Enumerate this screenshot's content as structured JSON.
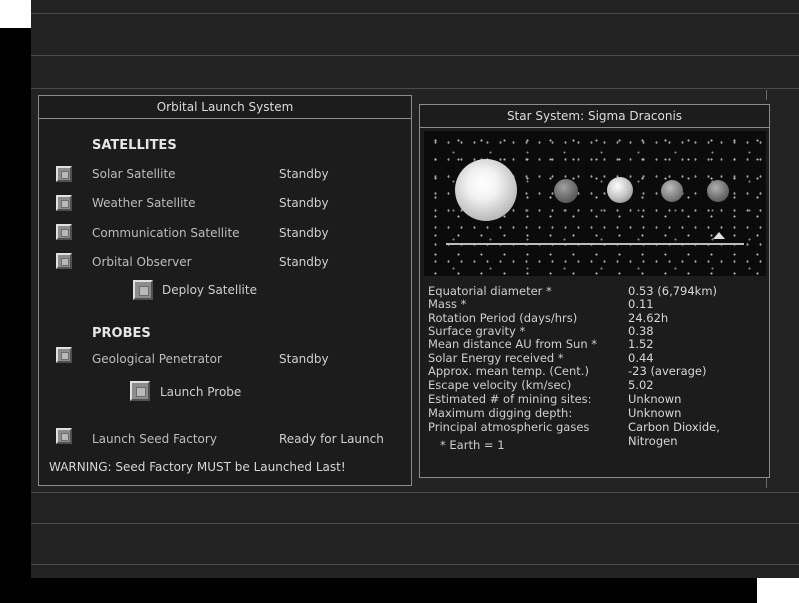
{
  "launch_panel": {
    "title": "Orbital Launch System",
    "satellites_header": "SATELLITES",
    "satellites": [
      {
        "label": "Solar Satellite",
        "status": "Standby"
      },
      {
        "label": "Weather Satellite",
        "status": "Standby"
      },
      {
        "label": "Communication Satellite",
        "status": "Standby"
      },
      {
        "label": "Orbital Observer",
        "status": "Standby"
      }
    ],
    "deploy_label": "Deploy Satellite",
    "probes_header": "PROBES",
    "probes": [
      {
        "label": "Geological Penetrator",
        "status": "Standby"
      }
    ],
    "launch_probe_label": "Launch Probe",
    "seed_factory": {
      "label": "Launch Seed Factory",
      "status": "Ready for Launch"
    },
    "warning": "WARNING: Seed Factory MUST be Launched Last!"
  },
  "star_panel": {
    "title": "Star System: Sigma Draconis",
    "planet_count": 4,
    "selected_planet_index": 4,
    "info": [
      {
        "label": "Equatorial diameter *",
        "value": "0.53 (6,794km)"
      },
      {
        "label": "Mass *",
        "value": "0.11"
      },
      {
        "label": "Rotation Period (days/hrs)",
        "value": "24.62h"
      },
      {
        "label": "Surface gravity *",
        "value": "0.38"
      },
      {
        "label": "Mean distance AU from Sun *",
        "value": "1.52"
      },
      {
        "label": "Solar Energy received *",
        "value": "0.44"
      },
      {
        "label": "Approx. mean temp. (Cent.)",
        "value": "-23 (average)"
      },
      {
        "label": "Escape velocity (km/sec)",
        "value": "5.02"
      },
      {
        "label": "Estimated # of mining sites:",
        "value": "Unknown"
      },
      {
        "label": "Maximum digging depth:",
        "value": "Unknown"
      },
      {
        "label": "Principal atmospheric gases",
        "value": "Carbon Dioxide,"
      }
    ],
    "gas_value_2": "Nitrogen",
    "footnote": "* Earth = 1"
  }
}
